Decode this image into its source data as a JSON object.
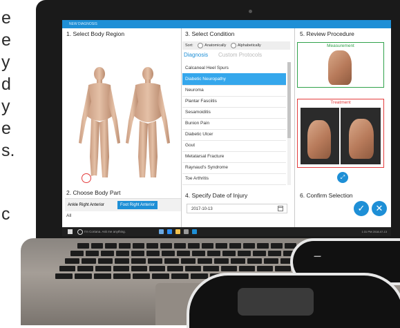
{
  "side_text": {
    "letters": [
      "e",
      "e",
      "y",
      "d",
      "y",
      "e",
      "s.",
      "",
      "c"
    ]
  },
  "app": {
    "title": "NEW DIAGNOSIS",
    "panels": {
      "select_body_region": "1. Select Body Region",
      "choose_body_part": "2. Choose Body Part",
      "select_condition": "3. Select Condition",
      "specify_date": "4. Specify Date of Injury",
      "review_procedure": "5. Review Procedure",
      "confirm_selection": "6. Confirm Selection"
    },
    "body_parts": {
      "options": [
        "Ankle Right Anterior",
        "Foot Right Anterior"
      ],
      "selected": "Foot Right Anterior",
      "all_label": "All"
    },
    "sort": {
      "label": "Sort:",
      "options": [
        "Anatomically",
        "Alphabetically"
      ]
    },
    "tabs": [
      "Diagnosis",
      "Custom Protocols"
    ],
    "conditions": [
      "Calcaneal Heel Spurs",
      "Diabetic Neuropathy",
      "Neuroma",
      "Plantar Fasciitis",
      "Sesamoiditis",
      "Bunion Pain",
      "Diabetic Ulcer",
      "Gout",
      "Metatarsal Fracture",
      "Raynaud's Syndrome",
      "Toe Arthritis"
    ],
    "selected_condition": "Diabetic Neuropathy",
    "date_value": "2017-10-13",
    "review": {
      "measurement_label": "Measurement",
      "treatment_label": "Treatment"
    }
  },
  "taskbar": {
    "search_placeholder": "I'm Cortana. Ask me anything.",
    "clock": "1:31 PM",
    "date": "2018-07-13"
  },
  "colors": {
    "accent": "#1e8fd6",
    "selected_row": "#35a7ec",
    "measurement_border": "#2fa24a",
    "treatment_border": "#e33b3b"
  }
}
